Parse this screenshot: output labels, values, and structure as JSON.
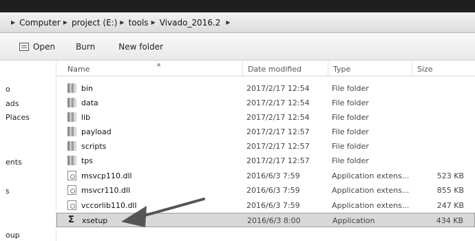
{
  "address": {
    "crumbs": [
      "Computer",
      "project (E:)",
      "tools",
      "Vivado_2016.2"
    ]
  },
  "toolbar": {
    "open_label": "Open",
    "burn_label": "Burn",
    "new_folder_label": "New folder"
  },
  "nav": {
    "items": [
      "o",
      "ads",
      "Places",
      "ents",
      "s",
      "oup"
    ]
  },
  "columns": {
    "name": "Name",
    "date": "Date modified",
    "type": "Type",
    "size": "Size"
  },
  "files": [
    {
      "name": "bin",
      "date": "2017/2/17 12:54",
      "type": "File folder",
      "size": "",
      "icon": "folder-icon"
    },
    {
      "name": "data",
      "date": "2017/2/17 12:54",
      "type": "File folder",
      "size": "",
      "icon": "folder-icon"
    },
    {
      "name": "lib",
      "date": "2017/2/17 12:54",
      "type": "File folder",
      "size": "",
      "icon": "folder-icon"
    },
    {
      "name": "payload",
      "date": "2017/2/17 12:57",
      "type": "File folder",
      "size": "",
      "icon": "folder-icon"
    },
    {
      "name": "scripts",
      "date": "2017/2/17 12:57",
      "type": "File folder",
      "size": "",
      "icon": "folder-icon"
    },
    {
      "name": "tps",
      "date": "2017/2/17 12:57",
      "type": "File folder",
      "size": "",
      "icon": "folder-icon"
    },
    {
      "name": "msvcp110.dll",
      "date": "2016/6/3 7:59",
      "type": "Application extens...",
      "size": "523 KB",
      "icon": "dll-icon"
    },
    {
      "name": "msvcr110.dll",
      "date": "2016/6/3 7:59",
      "type": "Application extens...",
      "size": "855 KB",
      "icon": "dll-icon"
    },
    {
      "name": "vccorlib110.dll",
      "date": "2016/6/3 7:59",
      "type": "Application extens...",
      "size": "247 KB",
      "icon": "dll-icon"
    },
    {
      "name": "xsetup",
      "date": "2016/6/3 8:00",
      "type": "Application",
      "size": "434 KB",
      "icon": "application-icon",
      "selected": true
    }
  ]
}
